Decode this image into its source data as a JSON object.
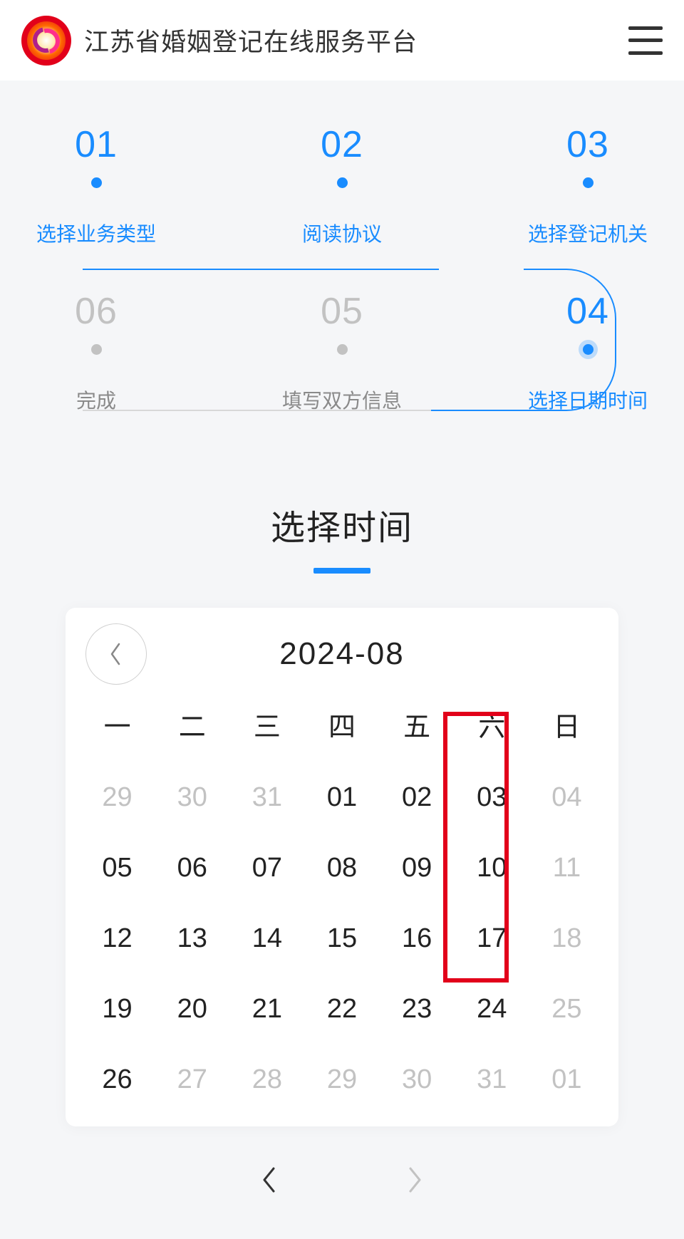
{
  "header": {
    "title": "江苏省婚姻登记在线服务平台"
  },
  "steps": {
    "top": [
      {
        "num": "01",
        "label": "选择业务类型",
        "state": "active"
      },
      {
        "num": "02",
        "label": "阅读协议",
        "state": "active"
      },
      {
        "num": "03",
        "label": "选择登记机关",
        "state": "active"
      }
    ],
    "bottom": [
      {
        "num": "06",
        "label": "完成",
        "state": "inactive"
      },
      {
        "num": "05",
        "label": "填写双方信息",
        "state": "inactive"
      },
      {
        "num": "04",
        "label": "选择日期时间",
        "state": "active current"
      }
    ]
  },
  "section": {
    "title": "选择时间"
  },
  "calendar": {
    "month_label": "2024-08",
    "weekdays": [
      "一",
      "二",
      "三",
      "四",
      "五",
      "六",
      "日"
    ],
    "rows": [
      [
        {
          "d": "29",
          "m": true
        },
        {
          "d": "30",
          "m": true
        },
        {
          "d": "31",
          "m": true
        },
        {
          "d": "01",
          "m": false
        },
        {
          "d": "02",
          "m": false
        },
        {
          "d": "03",
          "m": false
        },
        {
          "d": "04",
          "m": true
        }
      ],
      [
        {
          "d": "05",
          "m": false
        },
        {
          "d": "06",
          "m": false
        },
        {
          "d": "07",
          "m": false
        },
        {
          "d": "08",
          "m": false
        },
        {
          "d": "09",
          "m": false
        },
        {
          "d": "10",
          "m": false
        },
        {
          "d": "11",
          "m": true
        }
      ],
      [
        {
          "d": "12",
          "m": false
        },
        {
          "d": "13",
          "m": false
        },
        {
          "d": "14",
          "m": false
        },
        {
          "d": "15",
          "m": false
        },
        {
          "d": "16",
          "m": false
        },
        {
          "d": "17",
          "m": false
        },
        {
          "d": "18",
          "m": true
        }
      ],
      [
        {
          "d": "19",
          "m": false
        },
        {
          "d": "20",
          "m": false
        },
        {
          "d": "21",
          "m": false
        },
        {
          "d": "22",
          "m": false
        },
        {
          "d": "23",
          "m": false
        },
        {
          "d": "24",
          "m": false
        },
        {
          "d": "25",
          "m": true
        }
      ],
      [
        {
          "d": "26",
          "m": false
        },
        {
          "d": "27",
          "m": true
        },
        {
          "d": "28",
          "m": true
        },
        {
          "d": "29",
          "m": true
        },
        {
          "d": "30",
          "m": true
        },
        {
          "d": "31",
          "m": true
        },
        {
          "d": "01",
          "m": true
        }
      ]
    ]
  }
}
